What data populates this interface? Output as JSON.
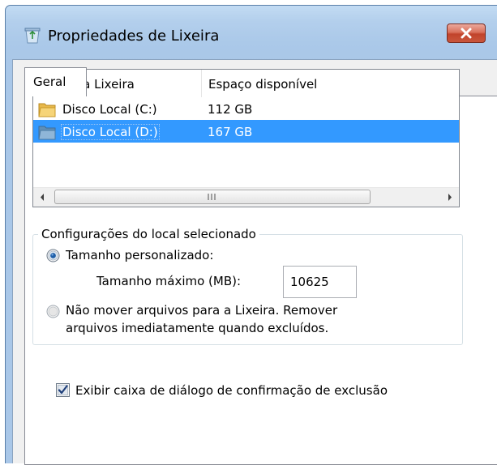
{
  "window": {
    "title": "Propriedades de Lixeira",
    "icon": "recycle-bin-icon",
    "close_icon": "close-icon"
  },
  "tabs": [
    {
      "label": "Geral",
      "selected": true
    }
  ],
  "locations": {
    "columns": [
      "Local da Lixeira",
      "Espaço disponível"
    ],
    "rows": [
      {
        "name": "Disco Local (C:)",
        "space": "112 GB",
        "selected": false
      },
      {
        "name": "Disco Local (D:)",
        "space": "167 GB",
        "selected": true
      }
    ],
    "scrollbar_grip": "III"
  },
  "settings": {
    "group_label": "Configurações do local selecionado",
    "custom_size_label": "Tamanho personalizado:",
    "max_size_label": "Tamanho máximo (MB):",
    "max_size_value": "10625",
    "custom_size_selected": true,
    "no_move_line1": "Não mover arquivos para a Lixeira. Remover",
    "no_move_line2": "arquivos imediatamente quando excluídos.",
    "no_move_selected": false
  },
  "confirm": {
    "label": "Exibir caixa de diálogo de confirmação de exclusão",
    "checked": true
  },
  "colors": {
    "selection": "#3399ff",
    "titlebar": "#b3cfec",
    "close_button": "#c9563c"
  }
}
